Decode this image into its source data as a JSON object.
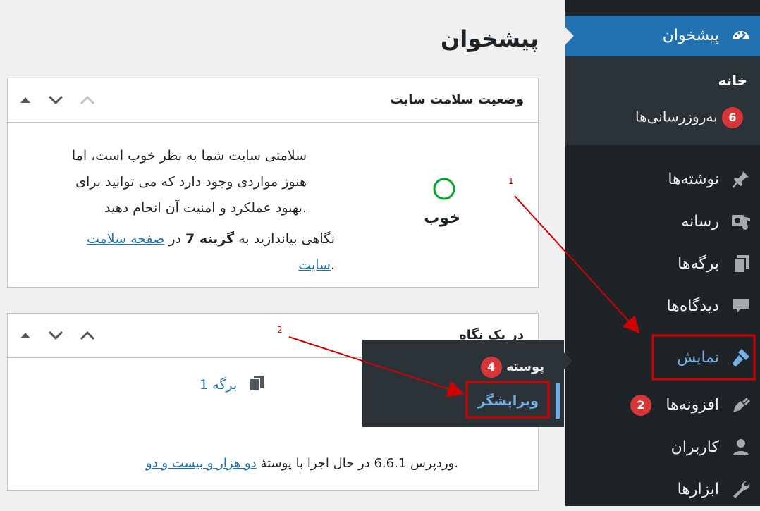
{
  "sidebar": {
    "dashboard_label": "پیشخوان",
    "submenu": {
      "home": "خانه",
      "updates": "به‌روزرسانی‌ها",
      "updates_badge": "6"
    },
    "items": [
      {
        "label": "نوشته‌ها",
        "icon": "pin-icon"
      },
      {
        "label": "رسانه",
        "icon": "media-icon"
      },
      {
        "label": "برگه‌ها",
        "icon": "pages-icon"
      },
      {
        "label": "دیدگاه‌ها",
        "icon": "comment-icon"
      },
      {
        "label": "نمایش",
        "icon": "paintbrush-icon"
      },
      {
        "label": "افزونه‌ها",
        "icon": "plugin-icon",
        "badge": "2"
      },
      {
        "label": "کاربران",
        "icon": "user-icon"
      },
      {
        "label": "ابزارها",
        "icon": "wrench-icon"
      }
    ]
  },
  "popup": {
    "theme_label": "پوسته",
    "theme_badge": "4",
    "editor_label": "ویرایشگر"
  },
  "main": {
    "title": "پیشخوان",
    "health": {
      "title": "وضعیت سلامت سایت",
      "status": "خوب",
      "line1": "سلامتی سایت شما به نظر خوب است، اما",
      "line2": "هنوز مواردی وجود دارد که می توانید برای",
      "line3": "بهبود عملکرد و امنیت آن انجام دهید.",
      "look_pre": "نگاهی بیاندازید به",
      "look_bold": "گزینه 7",
      "look_mid": "در",
      "look_link1": "صفحه سلامت",
      "look_link2": "سایت",
      "look_end": "."
    },
    "glance": {
      "title": "در یک نگاه",
      "pages": "1 برگه",
      "wp_pre": "وردپرس 6.6.1 در حال اجرا با پوستهٔ",
      "wp_theme": "دو هزار و بیست و دو",
      "wp_end": "."
    }
  },
  "annotations": {
    "one": "1",
    "two": "2"
  },
  "colors": {
    "sidebar_bg": "#1d2327",
    "submenu_bg": "#2c3338",
    "accent": "#2271b1",
    "badge": "#d63638",
    "highlight_text": "#72aee6",
    "annotation": "#d00000"
  }
}
